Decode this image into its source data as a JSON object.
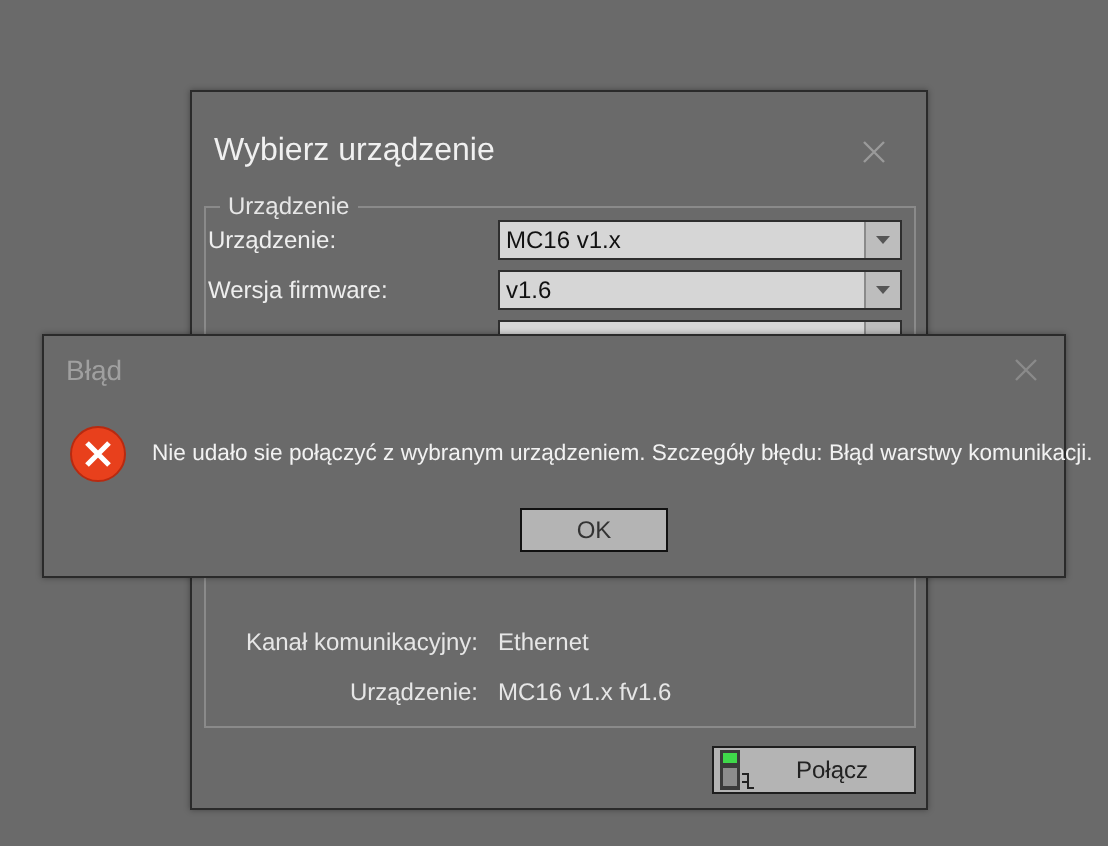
{
  "main_dialog": {
    "title": "Wybierz urządzenie",
    "group": {
      "title": "Urządzenie",
      "fields": [
        {
          "label": "Urządzenie:",
          "value": "MC16 v1.x"
        },
        {
          "label": "Wersja firmware:",
          "value": "v1.6"
        }
      ]
    },
    "summary": [
      {
        "label": "Kanał komunikacyjny:",
        "value": "Ethernet"
      },
      {
        "label": "Urządzenie:",
        "value": "MC16 v1.x fv1.6"
      }
    ],
    "connect_button": "Połącz"
  },
  "error_dialog": {
    "title": "Błąd",
    "message": "Nie udało sie połączyć z wybranym urządzeniem. Szczegóły błędu: Błąd warstwy komunikacji.",
    "buttons": [
      "OK"
    ]
  }
}
